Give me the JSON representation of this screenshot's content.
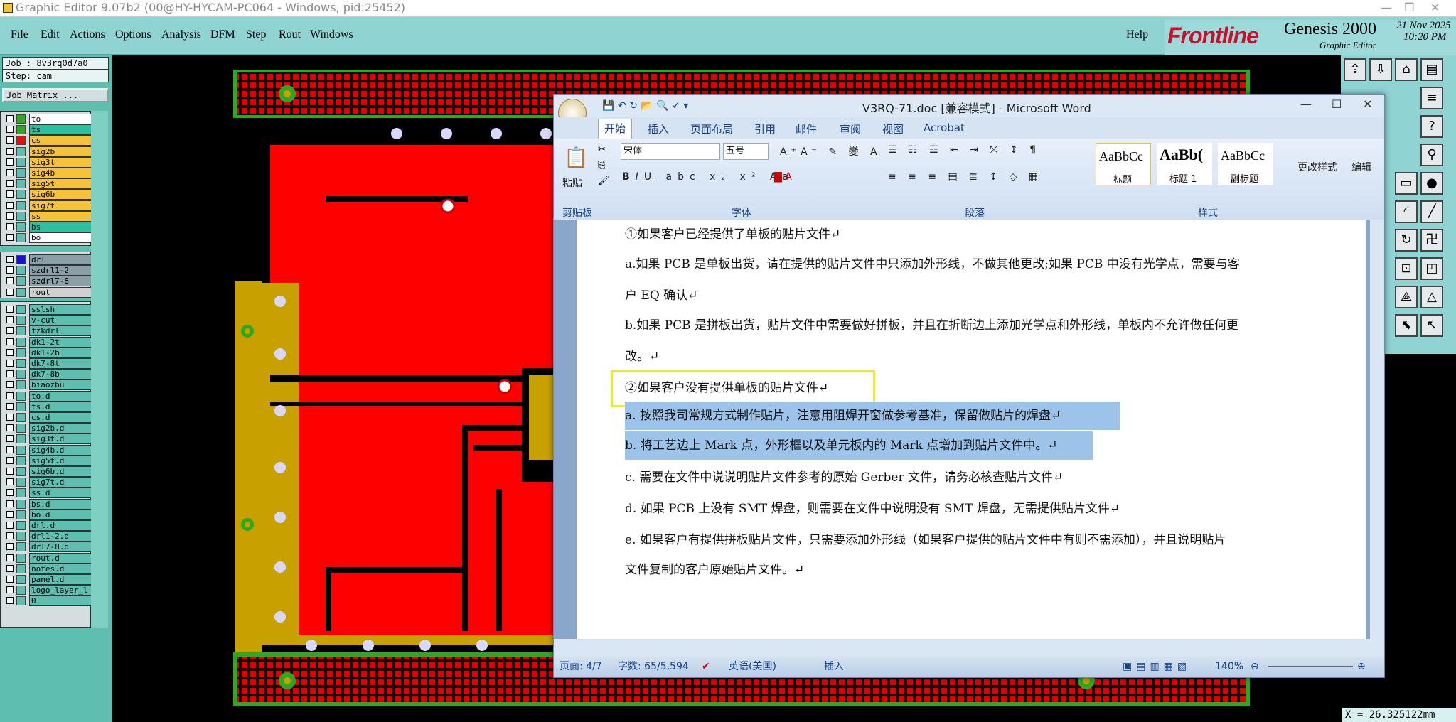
{
  "window": {
    "title": "Graphic Editor 9.07b2 (00@HY-HYCAM-PC064 - Windows, pid:25452)"
  },
  "menu": {
    "items": [
      "File",
      "Edit",
      "Actions",
      "Options",
      "Analysis",
      "DFM",
      "Step",
      "Rout",
      "Windows"
    ],
    "help": "Help"
  },
  "brand": {
    "logo": "Frontline",
    "product": "Genesis 2000",
    "subtitle": "Graphic Editor",
    "date": "21 Nov 2025",
    "time": "10:20 PM"
  },
  "job": {
    "job_label": "Job : 8v3rq0d7a0",
    "step_label": "Step: cam",
    "matrix_button": "Job Matrix ..."
  },
  "layers": {
    "board": [
      {
        "name": "to",
        "color": "#2ea820",
        "fill": "#ffffff"
      },
      {
        "name": "ts",
        "color": "#2ea820",
        "fill": "#2ebfa0"
      },
      {
        "name": "cs",
        "color": "#e01010",
        "fill": "#f5c23c"
      },
      {
        "name": "sig2b",
        "color": "#5ebfb0",
        "fill": "#f5c23c"
      },
      {
        "name": "sig3t",
        "color": "#5ebfb0",
        "fill": "#f5c23c"
      },
      {
        "name": "sig4b",
        "color": "#5ebfb0",
        "fill": "#f5c23c"
      },
      {
        "name": "sig5t",
        "color": "#5ebfb0",
        "fill": "#f5c23c"
      },
      {
        "name": "sig6b",
        "color": "#5ebfb0",
        "fill": "#f5c23c"
      },
      {
        "name": "sig7t",
        "color": "#5ebfb0",
        "fill": "#f5c23c"
      },
      {
        "name": "ss",
        "color": "#5ebfb0",
        "fill": "#f5c23c"
      },
      {
        "name": "bs",
        "color": "#5ebfb0",
        "fill": "#2ebfa0"
      },
      {
        "name": "bo",
        "color": "#5ebfb0",
        "fill": "#ffffff"
      }
    ],
    "drill": [
      {
        "name": "drl",
        "color": "#1010e0",
        "fill": "#8aa0a8"
      },
      {
        "name": "szdrl1-2",
        "color": "#5ebfb0",
        "fill": "#8aa0a8"
      },
      {
        "name": "szdrl7-8",
        "color": "#5ebfb0",
        "fill": "#8aa0a8"
      },
      {
        "name": "rout",
        "color": "#5ebfb0",
        "fill": "#d0d0d0"
      }
    ],
    "misc": [
      "sslsh",
      "v-cut",
      "fzkdrl",
      "dk1-2t",
      "dk1-2b",
      "dk7-8t",
      "dk7-8b",
      "biaozbu",
      "to.d",
      "ts.d",
      "cs.d",
      "sig2b.d",
      "sig3t.d",
      "sig4b.d",
      "sig5t.d",
      "sig6b.d",
      "sig7t.d",
      "ss.d",
      "bs.d",
      "bo.d",
      "drl.d",
      "drl1-2.d",
      "drl7-8.d",
      "rout.d",
      "notes.d",
      "panel.d",
      "logo_layer_l",
      "0"
    ]
  },
  "coordinate_readout": "X = 26.325122mm",
  "word": {
    "title": "V3RQ-71.doc [兼容模式] - Microsoft Word",
    "tabs": [
      "开始",
      "插入",
      "页面布局",
      "引用",
      "邮件",
      "审阅",
      "视图",
      "Acrobat"
    ],
    "font_name": "宋体",
    "font_size": "五号",
    "paste_label": "粘贴",
    "groups": [
      "剪贴板",
      "字体",
      "段落",
      "样式"
    ],
    "styles": [
      {
        "preview": "AaBbCc",
        "name": "标题"
      },
      {
        "preview": "AaBb(",
        "name": "标题 1"
      },
      {
        "preview": "AaBbCc",
        "name": "副标题"
      }
    ],
    "change_styles": "更改样式",
    "edit": "编辑",
    "lines": [
      "①如果客户已经提供了单板的贴片文件↵",
      "a.如果 PCB 是单板出货，请在提供的贴片文件中只添加外形线，不做其他更改;如果 PCB 中没有光学点，需要与客",
      "户 EQ 确认↵",
      "b.如果 PCB 是拼板出货，贴片文件中需要做好拼板，并且在折断边上添加光学点和外形线，单板内不允许做任何更",
      "改。↵",
      "②如果客户没有提供单板的贴片文件↵",
      "a. 按照我司常规方式制作贴片，注意用阻焊开窗做参考基准，保留做贴片的焊盘↵",
      "b. 将工艺边上 Mark 点，外形框以及单元板内的 Mark 点增加到贴片文件中。↵",
      "c. 需要在文件中说说明贴片文件参考的原始 Gerber 文件，请务必核查贴片文件↵",
      "d. 如果 PCB 上没有 SMT 焊盘，则需要在文件中说明没有 SMT 焊盘，无需提供贴片文件↵",
      "e. 如果客户有提供拼板贴片文件，只需要添加外形线（如果客户提供的贴片文件中有则不需添加），并且说明贴片",
      "文件复制的客户原始贴片文件。↵"
    ],
    "status": {
      "page": "页面: 4/7",
      "words": "字数: 65/5,594",
      "lang": "英语(美国)",
      "mode": "插入",
      "zoom": "140%"
    }
  }
}
